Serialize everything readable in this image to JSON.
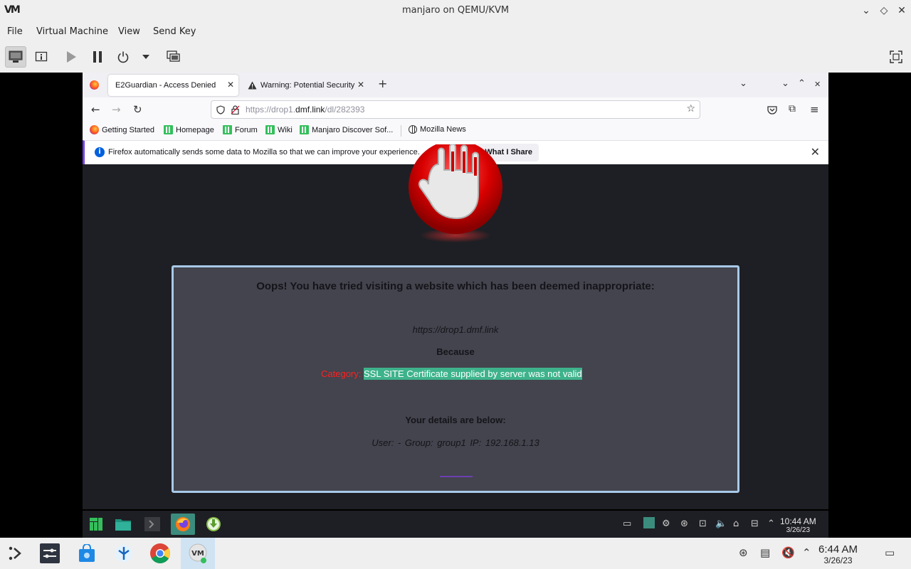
{
  "host": {
    "title": "manjaro on QEMU/KVM",
    "logo": "VM",
    "menu": [
      "File",
      "Virtual Machine",
      "View",
      "Send Key"
    ]
  },
  "firefox": {
    "tabs": [
      {
        "label": "E2Guardian - Access Denied",
        "active": true
      },
      {
        "label": "Warning: Potential Security",
        "active": false
      }
    ],
    "url": {
      "prefix": "https://drop1.",
      "domain": "dmf.link",
      "path": "/dl/282393"
    },
    "bookmarks": [
      "Getting Started",
      "Homepage",
      "Forum",
      "Wiki",
      "Manjaro Discover Sof...",
      "Mozilla News"
    ],
    "notification": {
      "text": "Firefox automatically sends some data to Mozilla so that we can improve your experience.",
      "button": "Choose What I Share"
    }
  },
  "page": {
    "heading": "Oops! You have tried visiting a website which has been deemed inappropriate:",
    "url": "https://drop1.dmf.link",
    "because": "Because",
    "category_label": "Category:",
    "reason": "SSL SITE   Certificate supplied by server was not valid",
    "details_heading": "Your details are below:",
    "user_line": "User: -   Group: group1   IP: 192.168.1.13"
  },
  "guest_taskbar": {
    "time": "10:44 AM",
    "date": "3/26/23"
  },
  "host_panel": {
    "time": "6:44 AM",
    "date": "3/26/23"
  }
}
